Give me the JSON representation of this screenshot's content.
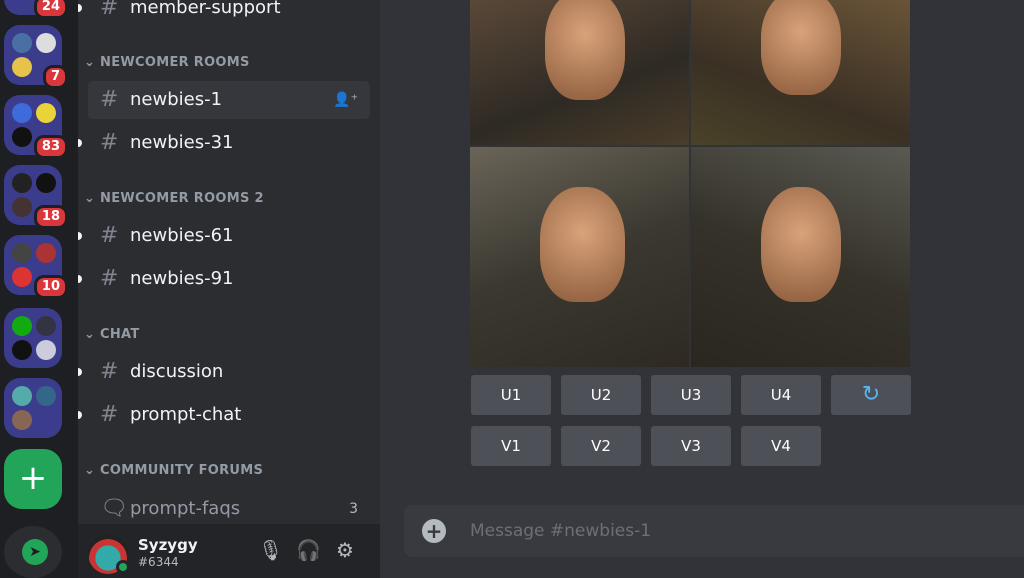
{
  "servers": {
    "badges": [
      "24",
      "7",
      "83",
      "18",
      "10"
    ],
    "add_label": "+",
    "explore_icon": "compass-icon"
  },
  "channels": {
    "top": {
      "name": "member-support"
    },
    "categories": [
      {
        "name": "NEWCOMER ROOMS",
        "items": [
          {
            "name": "newbies-1",
            "selected": true
          },
          {
            "name": "newbies-31"
          }
        ]
      },
      {
        "name": "NEWCOMER ROOMS 2",
        "items": [
          {
            "name": "newbies-61"
          },
          {
            "name": "newbies-91"
          }
        ]
      },
      {
        "name": "CHAT",
        "items": [
          {
            "name": "discussion"
          },
          {
            "name": "prompt-chat"
          }
        ]
      },
      {
        "name": "COMMUNITY FORUMS",
        "items": [
          {
            "name": "prompt-faqs",
            "count": "3"
          }
        ]
      }
    ]
  },
  "user": {
    "name": "Syzygy",
    "tag": "#6344"
  },
  "message": {
    "buttons_row1": [
      "U1",
      "U2",
      "U3",
      "U4"
    ],
    "refresh_icon": "↻",
    "buttons_row2": [
      "V1",
      "V2",
      "V3",
      "V4"
    ]
  },
  "composer": {
    "placeholder": "Message #newbies-1"
  },
  "colors": {
    "accent_green": "#23a559",
    "badge_red": "#da373c",
    "folder": "#3b3d8c"
  }
}
